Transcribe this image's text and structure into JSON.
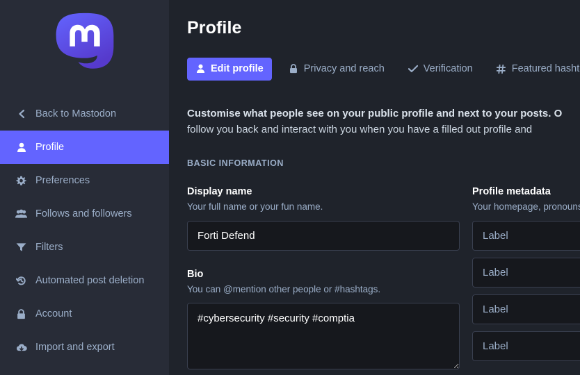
{
  "app": {
    "logo_icon": "mastodon-logo",
    "brand_color": "#6364ff"
  },
  "sidebar": {
    "back_link": {
      "label": "Back to Mastodon",
      "icon": "chevron-left-icon"
    },
    "items": [
      {
        "label": "Profile",
        "icon": "person-icon",
        "active": true
      },
      {
        "label": "Preferences",
        "icon": "gear-icon",
        "active": false
      },
      {
        "label": "Follows and followers",
        "icon": "users-icon",
        "active": false
      },
      {
        "label": "Filters",
        "icon": "filter-icon",
        "active": false
      },
      {
        "label": "Automated post deletion",
        "icon": "history-icon",
        "active": false
      },
      {
        "label": "Account",
        "icon": "lock-icon",
        "active": false
      },
      {
        "label": "Import and export",
        "icon": "cloud-download-icon",
        "active": false
      }
    ]
  },
  "header": {
    "title": "Profile"
  },
  "tabs": [
    {
      "label": "Edit profile",
      "icon": "person-icon",
      "active": true
    },
    {
      "label": "Privacy and reach",
      "icon": "lock-icon",
      "active": false
    },
    {
      "label": "Verification",
      "icon": "check-icon",
      "active": false
    },
    {
      "label": "Featured hashtags",
      "icon": "hashtag-icon",
      "active": false
    }
  ],
  "main": {
    "intro_line1": "Customise what people see on your public profile and next to your posts. O",
    "intro_line2": "follow you back and interact with you when you have a filled out profile and",
    "section_heading": "BASIC INFORMATION",
    "display_name": {
      "label": "Display name",
      "hint": "Your full name or your fun name.",
      "value": "Forti Defend"
    },
    "bio": {
      "label": "Bio",
      "hint": "You can @mention other people or #hashtags.",
      "value": "#cybersecurity #security #comptia"
    },
    "metadata": {
      "label": "Profile metadata",
      "hint": "Your homepage, pronouns, ag",
      "rows": [
        {
          "placeholder": "Label"
        },
        {
          "placeholder": "Label"
        },
        {
          "placeholder": "Label"
        },
        {
          "placeholder": "Label"
        }
      ]
    }
  }
}
